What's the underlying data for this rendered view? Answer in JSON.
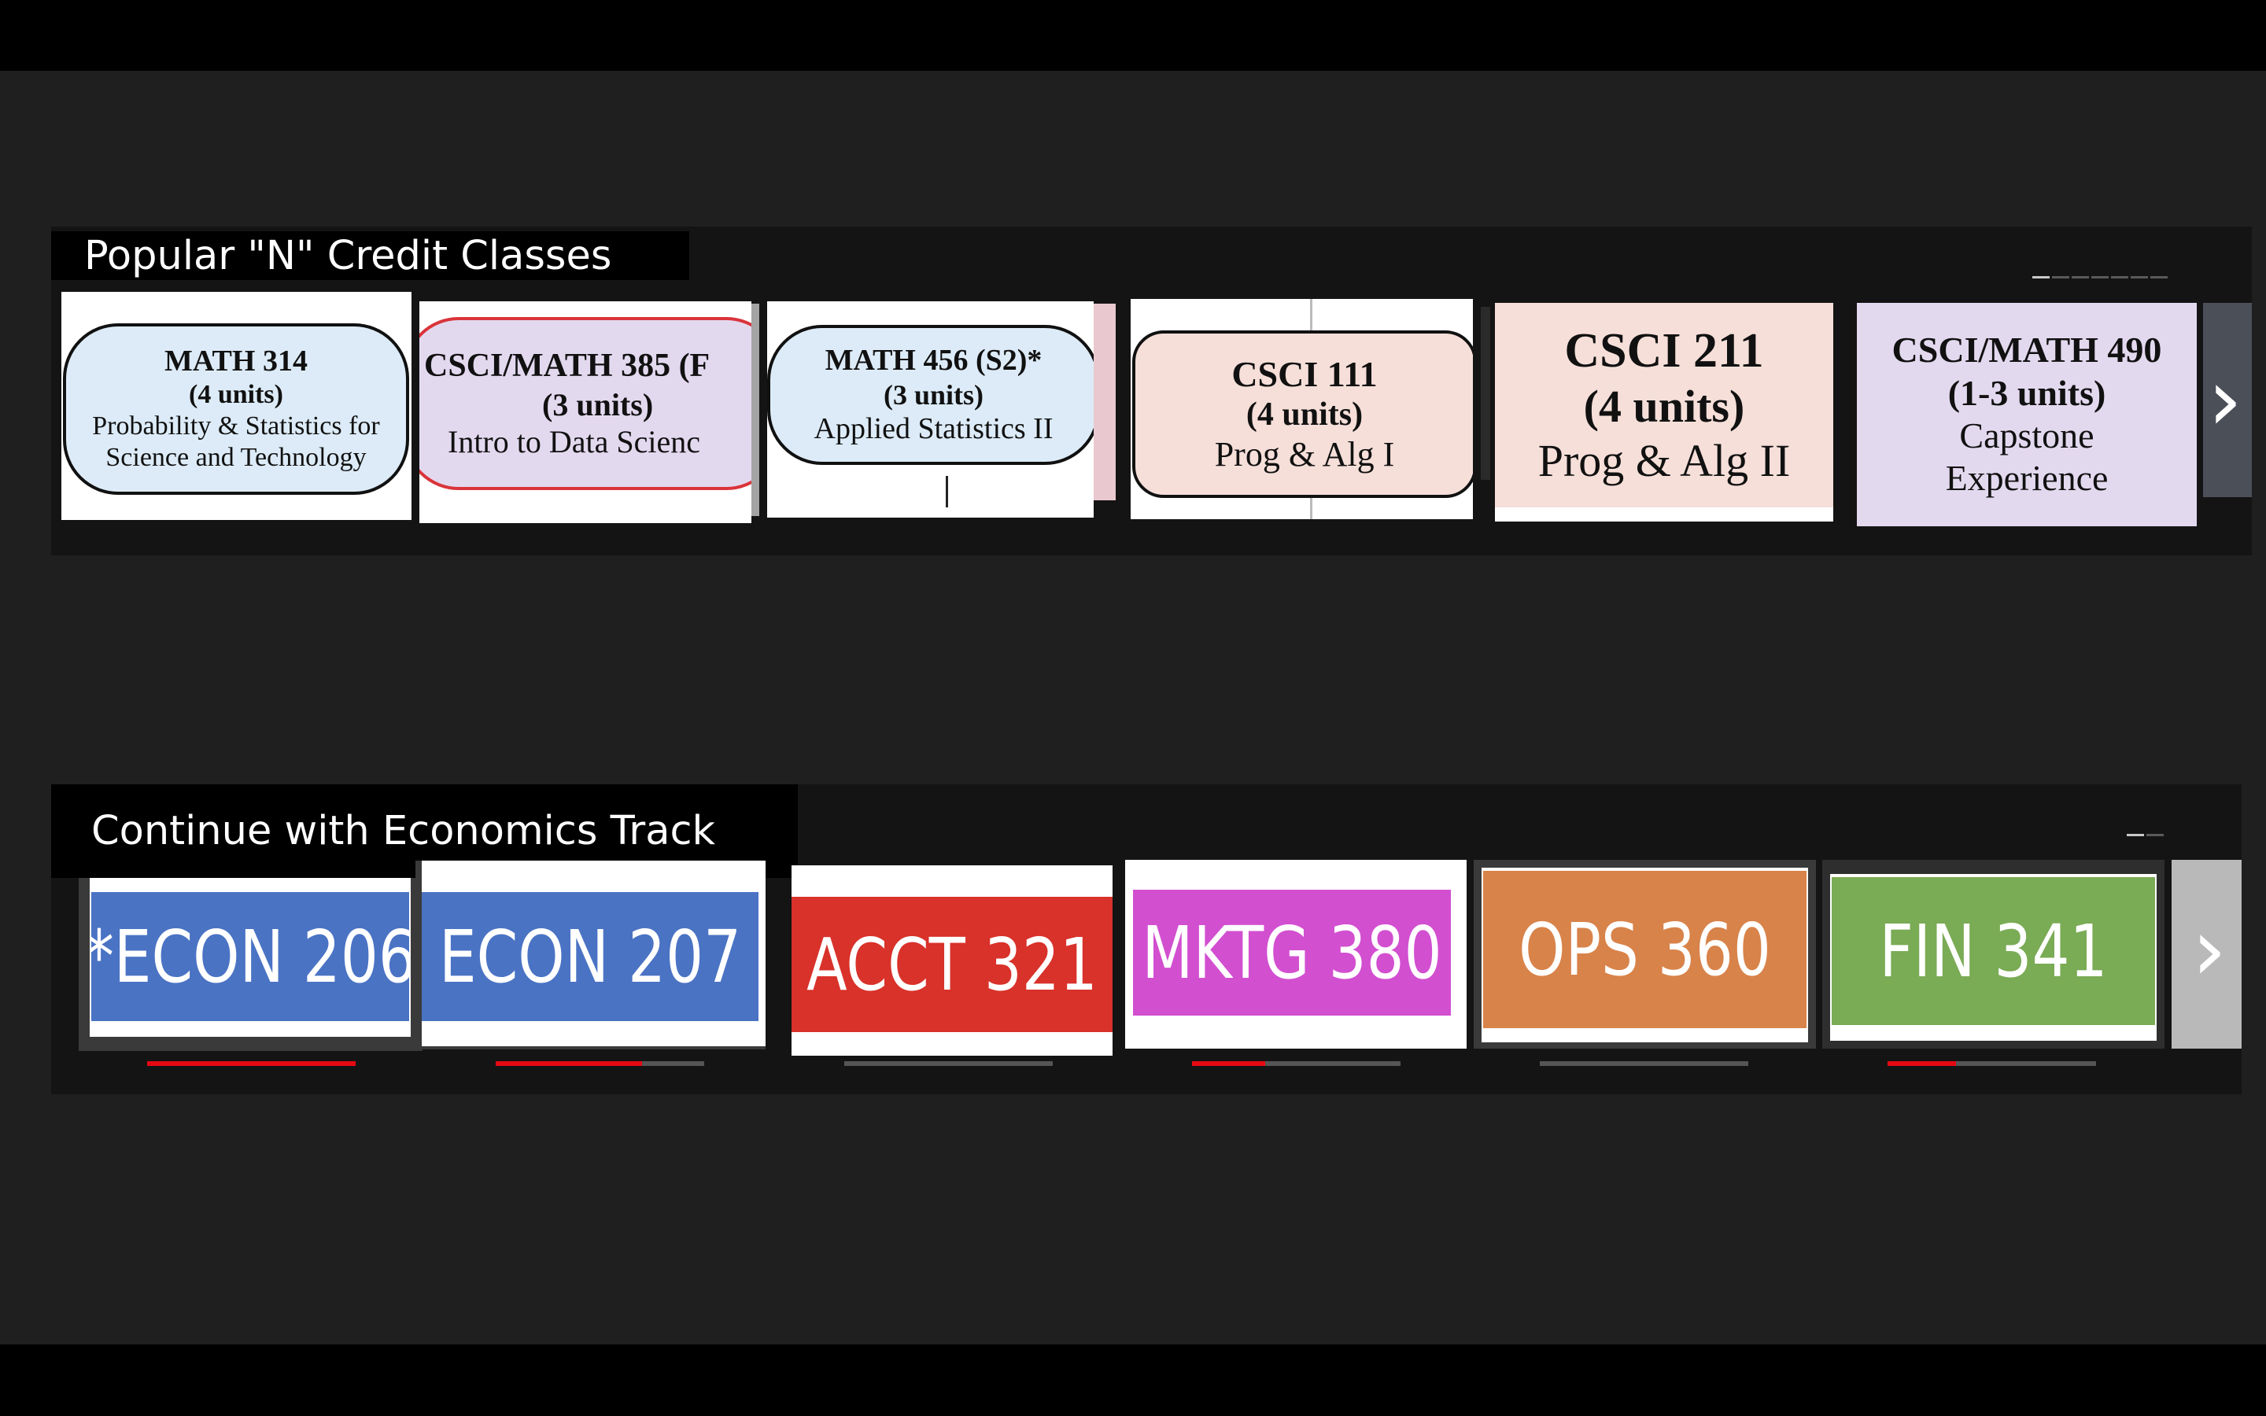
{
  "rows": [
    {
      "title": "Popular \"N\" Credit Classes",
      "tiles": [
        {
          "code": "MATH 314",
          "units": "(4 units)",
          "line1": "Probability & Statistics for",
          "line2": "Science and Technology",
          "fill": "#dcebf7",
          "border": "#111111"
        },
        {
          "code": "CSCI/MATH 385 (F",
          "units": "(3 units)",
          "line1": "Intro to Data Scienc",
          "line2": "",
          "fill": "#e3d9ef",
          "border": "#d9343a"
        },
        {
          "code": "MATH 456 (S2)*",
          "units": "(3 units)",
          "line1": "Applied Statistics II",
          "line2": "",
          "fill": "#dcebf7",
          "border": "#111111"
        },
        {
          "code": "CSCI 111",
          "units": "(4 units)",
          "line1": "Prog & Alg I",
          "line2": "",
          "fill": "#f6dfd9",
          "border": "#111111"
        },
        {
          "code": "CSCI 211",
          "units": "(4 units)",
          "line1": "Prog & Alg II",
          "line2": "",
          "fill": "#f6dfd9",
          "border": "#111111"
        },
        {
          "code": "CSCI/MATH 490",
          "units": "(1-3 units)",
          "line1": "Capstone",
          "line2": "Experience",
          "fill": "#e3d9ef",
          "border": "#d9343a"
        }
      ]
    },
    {
      "title": "Continue with Economics Track",
      "tiles": [
        {
          "label": "*ECON 206",
          "color": "#4a73c4",
          "progress": 1.0
        },
        {
          "label": "ECON 207",
          "color": "#4a73c4",
          "progress": 0.7
        },
        {
          "label": "ACCT 321",
          "color": "#d8322a",
          "progress": 0.0
        },
        {
          "label": "MKTG 380",
          "color": "#d24fd0",
          "progress": 0.35
        },
        {
          "label": "OPS 360",
          "color": "#d8834a",
          "progress": 0.0
        },
        {
          "label": "FIN 341",
          "color": "#7aab55",
          "progress": 0.33
        }
      ]
    }
  ],
  "icons": {
    "next": "chevron-right-icon",
    "next_glyph": "›"
  },
  "colors": {
    "background": "#1f1f1f",
    "row_background": "#141414",
    "progress": "#e50914"
  }
}
